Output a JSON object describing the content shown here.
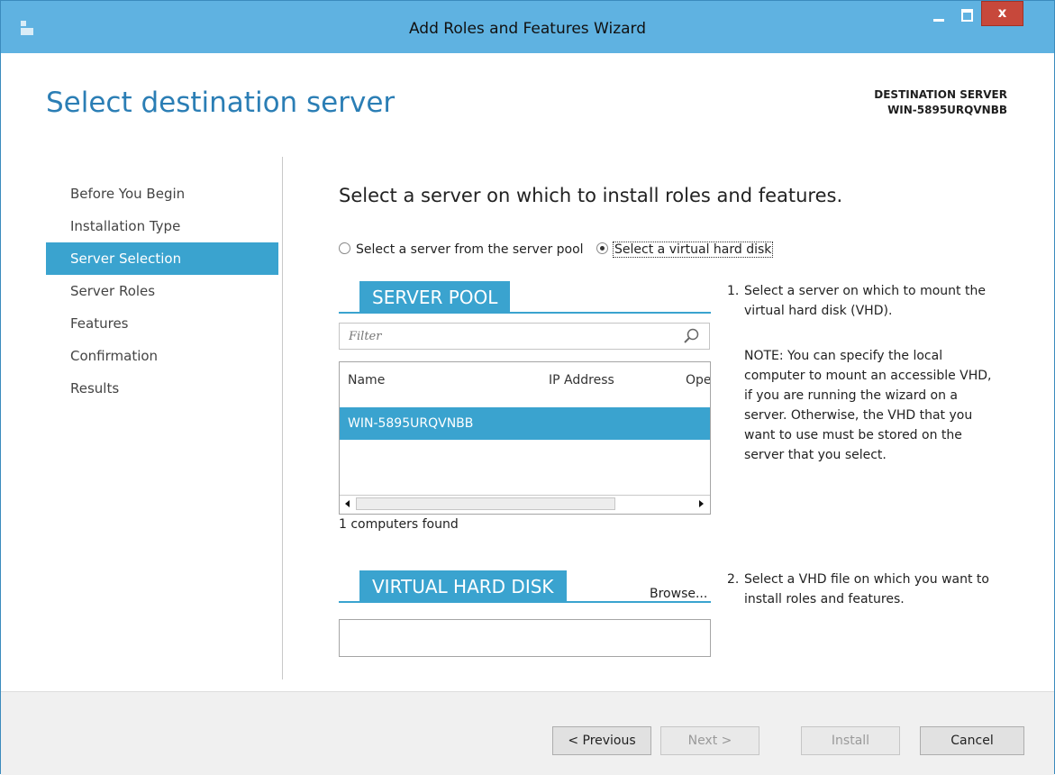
{
  "window": {
    "title": "Add Roles and Features Wizard",
    "close_label": "x"
  },
  "page": {
    "title": "Select destination server",
    "destination_label": "DESTINATION SERVER",
    "destination_value": "WIN-5895URQVNBB"
  },
  "nav": {
    "items": [
      {
        "label": "Before You Begin",
        "active": false
      },
      {
        "label": "Installation Type",
        "active": false
      },
      {
        "label": "Server Selection",
        "active": true
      },
      {
        "label": "Server Roles",
        "active": false
      },
      {
        "label": "Features",
        "active": false
      },
      {
        "label": "Confirmation",
        "active": false
      },
      {
        "label": "Results",
        "active": false
      }
    ]
  },
  "main": {
    "heading": "Select a server on which to install roles and features.",
    "options": {
      "pool_label": "Select a server from the server pool",
      "vhd_label": "Select a virtual hard disk",
      "selected": "vhd"
    },
    "server_pool": {
      "title": "SERVER POOL",
      "filter_placeholder": "Filter",
      "columns": [
        "Name",
        "IP Address",
        "Ope"
      ],
      "rows": [
        {
          "name": "WIN-5895URQVNBB",
          "selected": true
        }
      ],
      "count_text": "1 computers found"
    },
    "vhd": {
      "title": "VIRTUAL HARD DISK",
      "browse_label": "Browse...",
      "value": ""
    },
    "help": {
      "step1_num": "1.",
      "step1_text": "Select a server on which to mount the virtual hard disk (VHD).",
      "note_text": "NOTE: You can specify the local computer to mount an accessible VHD, if you are running the wizard on a server. Otherwise, the VHD that you want to use must be stored on the server that you select.",
      "step2_num": "2.",
      "step2_text": "Select a VHD file on which you want to install roles and features."
    }
  },
  "footer": {
    "previous_label": "< Previous",
    "next_label": "Next >",
    "install_label": "Install",
    "cancel_label": "Cancel"
  },
  "colors": {
    "accent": "#3aa3cf",
    "title_bar": "#5fb2e1",
    "close_button": "#c7483b",
    "page_title": "#2b7eb5"
  }
}
